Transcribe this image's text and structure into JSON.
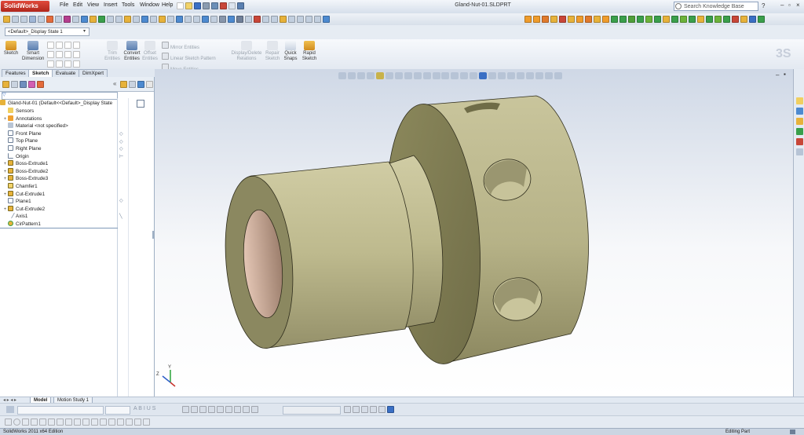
{
  "app": {
    "logo_text": "SolidWorks",
    "document_title": "Gland-Nut-01.SLDPRT",
    "menus": [
      "File",
      "Edit",
      "View",
      "Insert",
      "Tools",
      "Window",
      "Help"
    ],
    "search_placeholder": "Search Knowledge Base"
  },
  "config": {
    "selector_value": "<Default>_Display State 1"
  },
  "command_manager": {
    "items": [
      {
        "label": "Sketch",
        "enabled": true
      },
      {
        "label": "Smart Dimension",
        "enabled": true
      },
      {
        "label": "Trim Entities",
        "enabled": false
      },
      {
        "label": "Convert Entities",
        "enabled": true
      },
      {
        "label": "Offset Entities",
        "enabled": false
      },
      {
        "label": "Mirror Entities",
        "enabled": false
      },
      {
        "label": "Linear Sketch Pattern",
        "enabled": false
      },
      {
        "label": "Move Entities",
        "enabled": false
      },
      {
        "label": "Display/Delete Relations",
        "enabled": false
      },
      {
        "label": "Repair Sketch",
        "enabled": false
      },
      {
        "label": "Quick Snaps",
        "enabled": true
      },
      {
        "label": "Rapid Sketch",
        "enabled": true
      }
    ]
  },
  "tabs": {
    "items": [
      {
        "label": "Features",
        "active": false
      },
      {
        "label": "Sketch",
        "active": true
      },
      {
        "label": "Evaluate",
        "active": false
      },
      {
        "label": "DimXpert",
        "active": false
      }
    ]
  },
  "feature_tree": {
    "root": "Gland-Nut-01  (Default<<Default>_Display State",
    "items": [
      {
        "label": "Sensors",
        "icon": "folder-icon",
        "expand": false
      },
      {
        "label": "Annotations",
        "icon": "annotation-icon",
        "expand": true
      },
      {
        "label": "Material <not specified>",
        "icon": "material-icon",
        "expand": false
      },
      {
        "label": "Front Plane",
        "icon": "plane-icon",
        "expand": false
      },
      {
        "label": "Top Plane",
        "icon": "plane-icon",
        "expand": false
      },
      {
        "label": "Right Plane",
        "icon": "plane-icon",
        "expand": false
      },
      {
        "label": "Origin",
        "icon": "origin-icon",
        "expand": false
      },
      {
        "label": "Boss-Extrude1",
        "icon": "extrude-icon",
        "expand": true
      },
      {
        "label": "Boss-Extrude2",
        "icon": "extrude-icon",
        "expand": true
      },
      {
        "label": "Boss-Extrude3",
        "icon": "extrude-icon",
        "expand": true
      },
      {
        "label": "Chamfer1",
        "icon": "chamfer-icon",
        "expand": false
      },
      {
        "label": "Cut-Extrude1",
        "icon": "cut-icon",
        "expand": true
      },
      {
        "label": "Plane1",
        "icon": "plane-icon",
        "expand": false
      },
      {
        "label": "Cut-Extrude2",
        "icon": "cut-icon",
        "expand": true
      },
      {
        "label": "Axis1",
        "icon": "axis-icon",
        "expand": false
      },
      {
        "label": "CirPattern1",
        "icon": "pattern-icon",
        "expand": false
      }
    ]
  },
  "bottom_tabs": [
    {
      "label": "Model",
      "active": true
    },
    {
      "label": "Motion Study 1",
      "active": false
    }
  ],
  "status": {
    "left": "SolidWorks 2011 x64 Edition",
    "right": "Editing Part"
  },
  "colors": {
    "part_body": "#b9b58b",
    "part_dark": "#8d895e",
    "bore": "#c9aa98",
    "accent": "#c8322a"
  },
  "triad": {
    "y_label": "Y",
    "z_label": "Z"
  }
}
